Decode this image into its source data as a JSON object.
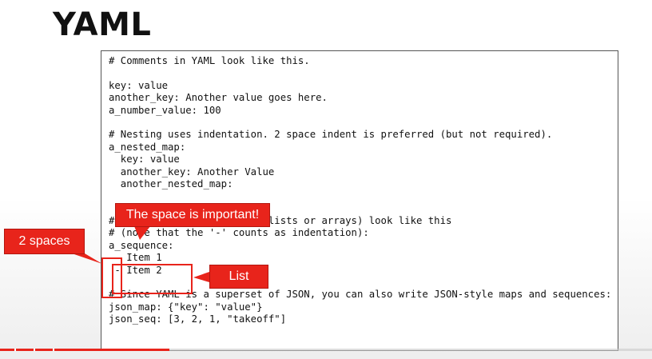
{
  "slide": {
    "title": "YAML"
  },
  "code": {
    "lines": [
      "# Comments in YAML look like this.",
      "",
      "key: value",
      "another_key: Another value goes here.",
      "a_number_value: 100",
      "",
      "# Nesting uses indentation. 2 space indent is preferred (but not required).",
      "a_nested_map:",
      "  key: value",
      "  another_key: Another Value",
      "  another_nested_map:",
      "",
      "",
      "# Sequences (equivalent to lists or arrays) look like this",
      "# (note that the '-' counts as indentation):",
      "a_sequence:",
      " - Item 1",
      " - Item 2",
      "",
      "# Since YAML is a superset of JSON, you can also write JSON-style maps and sequences:",
      "json_map: {\"key\": \"value\"}",
      "json_seq: [3, 2, 1, \"takeoff\"]"
    ]
  },
  "callouts": {
    "spaces": "2 spaces",
    "important": "The space is important!",
    "list": "List"
  },
  "colors": {
    "accent": "#e8241b",
    "code_border": "#555555",
    "text": "#111111"
  },
  "video_progress": {
    "fraction": 0.26
  }
}
